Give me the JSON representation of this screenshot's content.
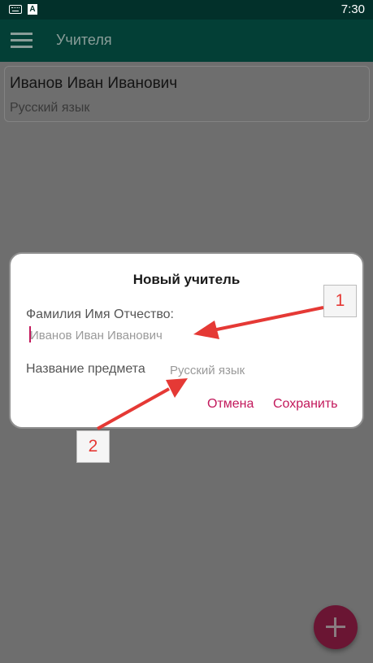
{
  "status_bar": {
    "time": "7:30",
    "icons": [
      "keyboard-icon",
      "a-notification-icon"
    ]
  },
  "app_bar": {
    "title": "Учителя",
    "menu_icon": "hamburger-menu-icon"
  },
  "list": {
    "items": [
      {
        "name": "Иванов Иван Иванович",
        "subject": "Русский язык"
      }
    ]
  },
  "dialog": {
    "title": "Новый учитель",
    "fio_label": "Фамилия Имя Отчество:",
    "fio_placeholder": "Иванов Иван Иванович",
    "fio_value": "",
    "subject_label": "Название предмета",
    "subject_placeholder": "Русский язык",
    "subject_value": "",
    "cancel_label": "Отмена",
    "save_label": "Сохранить"
  },
  "annotations": {
    "marker_1": "1",
    "marker_2": "2"
  },
  "fab": {
    "icon": "plus-icon"
  },
  "colors": {
    "status_bar": "#02302a",
    "app_bar": "#033f36",
    "accent": "#c2185b",
    "fab": "#6a1533",
    "annotation": "#e53935",
    "scrim": "#6e6e6e"
  }
}
